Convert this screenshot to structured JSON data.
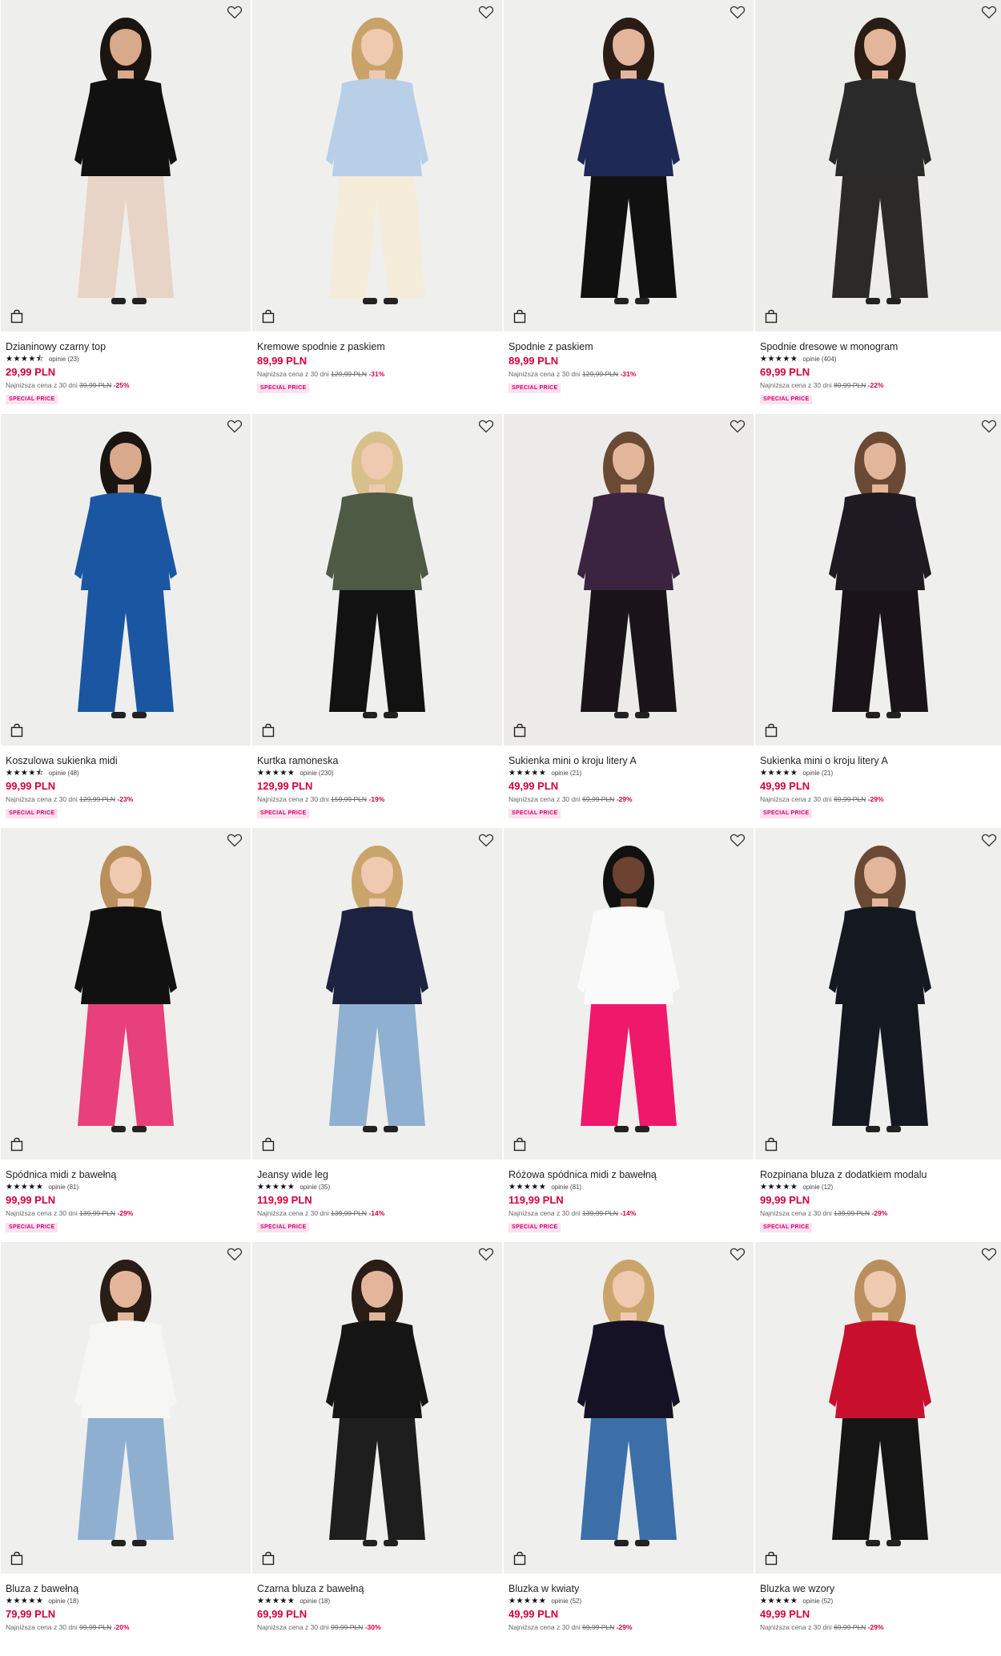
{
  "products": [
    {
      "name": "Dzianinowy czarny top",
      "reviews": "opinie (23)",
      "rating": 4.5,
      "price": "29,99 PLN",
      "lowest_prefix": "Najniższa cena z 30 dni",
      "old_price": "39,99 PLN",
      "discount": "-25%",
      "badge": "SPECIAL PRICE",
      "colors": {
        "bg": "#eeeeec",
        "top": "#111111",
        "bottom": "#e8d3c7",
        "skin": "#d9a98c",
        "hair": "#1b1512"
      }
    },
    {
      "name": "Kremowe spodnie z paskiem",
      "reviews": "",
      "rating": 0,
      "price": "89,99 PLN",
      "lowest_prefix": "Najniższa cena z 30 dni",
      "old_price": "129,99 PLN",
      "discount": "-31%",
      "badge": "SPECIAL PRICE",
      "colors": {
        "bg": "#efefed",
        "top": "#b9cfe8",
        "bottom": "#f4ecd9",
        "skin": "#efc9b0",
        "hair": "#c9a26a"
      }
    },
    {
      "name": "Spodnie z paskiem",
      "reviews": "",
      "rating": 0,
      "price": "89,99 PLN",
      "lowest_prefix": "Najniższa cena z 30 dni",
      "old_price": "129,99 PLN",
      "discount": "-31%",
      "badge": "SPECIAL PRICE",
      "colors": {
        "bg": "#efefed",
        "top": "#1e2a55",
        "bottom": "#111111",
        "skin": "#e3b69b",
        "hair": "#2a1d16"
      }
    },
    {
      "name": "Spodnie dresowe w monogram",
      "reviews": "opinie (404)",
      "rating": 5,
      "price": "69,99 PLN",
      "lowest_prefix": "Najniższa cena z 30 dni",
      "old_price": "89,99 PLN",
      "discount": "-22%",
      "badge": "SPECIAL PRICE",
      "colors": {
        "bg": "#ecece9",
        "top": "#2a2a2a",
        "bottom": "#2c2a28",
        "skin": "#e3b69b",
        "hair": "#2a1d16"
      }
    },
    {
      "name": "Koszulowa sukienka midi",
      "reviews": "opinie (48)",
      "rating": 4.5,
      "price": "99,99 PLN",
      "lowest_prefix": "Najniższa cena z 30 dni",
      "old_price": "129,99 PLN",
      "discount": "-23%",
      "badge": "SPECIAL PRICE",
      "colors": {
        "bg": "#eeeeec",
        "top": "#1b56a3",
        "bottom": "#1b56a3",
        "skin": "#d9a98c",
        "hair": "#1b1512"
      }
    },
    {
      "name": "Kurtka ramoneska",
      "reviews": "opinie (230)",
      "rating": 5,
      "price": "129,99 PLN",
      "lowest_prefix": "Najniższa cena z 30 dni",
      "old_price": "159,99 PLN",
      "discount": "-19%",
      "badge": "SPECIAL PRICE",
      "colors": {
        "bg": "#efefed",
        "top": "#4e5a44",
        "bottom": "#121212",
        "skin": "#efc9b0",
        "hair": "#d8c08a"
      }
    },
    {
      "name": "Sukienka mini o kroju litery A",
      "reviews": "opinie (21)",
      "rating": 5,
      "price": "49,99 PLN",
      "lowest_prefix": "Najniższa cena z 30 dni",
      "old_price": "69,99 PLN",
      "discount": "-29%",
      "badge": "SPECIAL PRICE",
      "colors": {
        "bg": "#ecebe9",
        "top": "#3a2440",
        "bottom": "#1a1418",
        "skin": "#e3b69b",
        "hair": "#6b4a35"
      }
    },
    {
      "name": "Sukienka mini o kroju litery A",
      "reviews": "opinie (21)",
      "rating": 5,
      "price": "49,99 PLN",
      "lowest_prefix": "Najniższa cena z 30 dni",
      "old_price": "69,99 PLN",
      "discount": "-29%",
      "badge": "SPECIAL PRICE",
      "colors": {
        "bg": "#efefed",
        "top": "#1d1a22",
        "bottom": "#1a1418",
        "skin": "#e3b69b",
        "hair": "#6b4a35"
      }
    },
    {
      "name": "Spódnica midi z bawełną",
      "reviews": "opinie (81)",
      "rating": 5,
      "price": "99,99 PLN",
      "lowest_prefix": "Najniższa cena z 30 dni",
      "old_price": "139,99 PLN",
      "discount": "-29%",
      "badge": "SPECIAL PRICE",
      "colors": {
        "bg": "#efefed",
        "top": "#111111",
        "bottom": "#e8407a",
        "skin": "#efc9b0",
        "hair": "#b9905d"
      }
    },
    {
      "name": "Jeansy wide leg",
      "reviews": "opinie (35)",
      "rating": 5,
      "price": "119,99 PLN",
      "lowest_prefix": "Najniższa cena z 30 dni",
      "old_price": "139,99 PLN",
      "discount": "-14%",
      "badge": "SPECIAL PRICE",
      "colors": {
        "bg": "#efefed",
        "top": "#1b2340",
        "bottom": "#8fb0d1",
        "skin": "#efc9b0",
        "hair": "#caa56b"
      }
    },
    {
      "name": "Różowa spódnica midi z bawełną",
      "reviews": "opinie (81)",
      "rating": 5,
      "price": "119,99 PLN",
      "lowest_prefix": "Najniższa cena z 30 dni",
      "old_price": "139,99 PLN",
      "discount": "-14%",
      "badge": "SPECIAL PRICE",
      "colors": {
        "bg": "#efefed",
        "top": "#fafafa",
        "bottom": "#f0186a",
        "skin": "#6b4330",
        "hair": "#111111"
      }
    },
    {
      "name": "Rozpinana bluza z dodatkiem modalu",
      "reviews": "opinie (12)",
      "rating": 5,
      "price": "99,99 PLN",
      "lowest_prefix": "Najniższa cena z 30 dni",
      "old_price": "139,99 PLN",
      "discount": "-29%",
      "badge": "SPECIAL PRICE",
      "colors": {
        "bg": "#efefed",
        "top": "#141821",
        "bottom": "#141821",
        "skin": "#e3b69b",
        "hair": "#6b4a35"
      }
    },
    {
      "name": "Bluza z bawełną",
      "reviews": "opinie (18)",
      "rating": 5,
      "price": "79,99 PLN",
      "lowest_prefix": "Najniższa cena z 30 dni",
      "old_price": "99,99 PLN",
      "discount": "-20%",
      "badge": "",
      "colors": {
        "bg": "#efefed",
        "top": "#f6f6f3",
        "bottom": "#8eafd0",
        "skin": "#e3b69b",
        "hair": "#2a1d16"
      }
    },
    {
      "name": "Czarna bluza z bawełną",
      "reviews": "opinie (18)",
      "rating": 5,
      "price": "69,99 PLN",
      "lowest_prefix": "Najniższa cena z 30 dni",
      "old_price": "99,99 PLN",
      "discount": "-30%",
      "badge": "",
      "colors": {
        "bg": "#efefed",
        "top": "#151515",
        "bottom": "#1e1e1e",
        "skin": "#e3b69b",
        "hair": "#2a1d16"
      }
    },
    {
      "name": "Bluzka w kwiaty",
      "reviews": "opinie (52)",
      "rating": 5,
      "price": "49,99 PLN",
      "lowest_prefix": "Najniższa cena z 30 dni",
      "old_price": "69,99 PLN",
      "discount": "-29%",
      "badge": "",
      "colors": {
        "bg": "#efefed",
        "top": "#161225",
        "bottom": "#3c6fa8",
        "skin": "#efc9b0",
        "hair": "#caa56b"
      }
    },
    {
      "name": "Bluzka we wzory",
      "reviews": "opinie (52)",
      "rating": 5,
      "price": "49,99 PLN",
      "lowest_prefix": "Najniższa cena z 30 dni",
      "old_price": "69,99 PLN",
      "discount": "-29%",
      "badge": "",
      "colors": {
        "bg": "#efefed",
        "top": "#c8102e",
        "bottom": "#151515",
        "skin": "#efc9b0",
        "hair": "#b9905d"
      }
    }
  ],
  "icons": {
    "wishlist": "heart-outline-icon",
    "add_to_cart": "shopping-bag-icon",
    "star": "star-icon"
  }
}
